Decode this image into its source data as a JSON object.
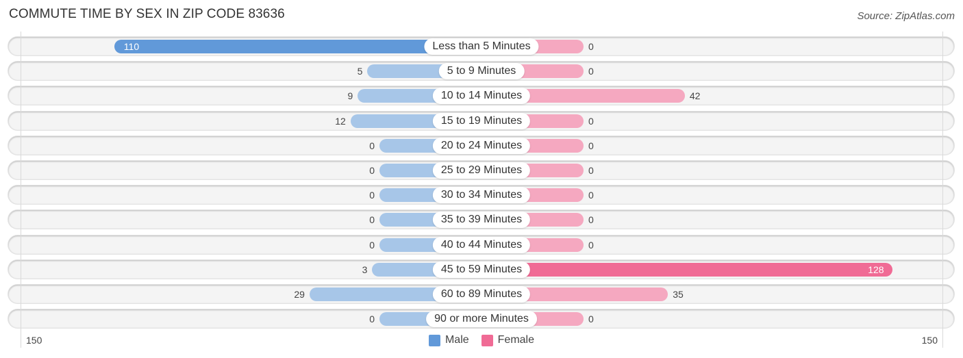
{
  "chart_data": {
    "type": "bar",
    "orientation": "horizontal-diverging",
    "title": "COMMUTE TIME BY SEX IN ZIP CODE 83636",
    "source": "Source: ZipAtlas.com",
    "categories": [
      "Less than 5 Minutes",
      "5 to 9 Minutes",
      "10 to 14 Minutes",
      "15 to 19 Minutes",
      "20 to 24 Minutes",
      "25 to 29 Minutes",
      "30 to 34 Minutes",
      "35 to 39 Minutes",
      "40 to 44 Minutes",
      "45 to 59 Minutes",
      "60 to 89 Minutes",
      "90 or more Minutes"
    ],
    "series": [
      {
        "name": "Male",
        "color": "#6199d9",
        "light_color": "#a7c6e8",
        "values": [
          110,
          5,
          9,
          12,
          0,
          0,
          0,
          0,
          0,
          3,
          29,
          0
        ]
      },
      {
        "name": "Female",
        "color": "#f06b95",
        "light_color": "#f5a8c0",
        "values": [
          0,
          0,
          42,
          0,
          0,
          0,
          0,
          0,
          0,
          128,
          35,
          0
        ]
      }
    ],
    "axis": {
      "left_tick": "150",
      "right_tick": "150",
      "max": 150
    },
    "legend": {
      "position": "bottom-center",
      "items": [
        {
          "label": "Male",
          "color": "#6199d9"
        },
        {
          "label": "Female",
          "color": "#f06b95"
        }
      ]
    }
  }
}
